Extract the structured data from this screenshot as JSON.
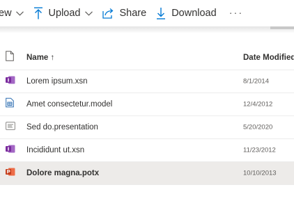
{
  "toolbar": {
    "view_label": "ew",
    "upload_label": "Upload",
    "share_label": "Share",
    "download_label": "Download",
    "more_label": "···"
  },
  "columns": {
    "name": "Name ↑",
    "date": "Date Modified"
  },
  "files": [
    {
      "name": "Lorem ipsum.xsn",
      "date": "8/1/2014",
      "icon": "infopath-file-icon",
      "color": "#7b2c9e"
    },
    {
      "name": "Amet consectetur.model",
      "date": "12/4/2012",
      "icon": "model-file-icon",
      "color": "#2b6cb0"
    },
    {
      "name": "Sed do.presentation",
      "date": "5/20/2020",
      "icon": "presentation-file-icon",
      "color": "#8a8886"
    },
    {
      "name": "Incididunt ut.xsn",
      "date": "11/23/2012",
      "icon": "infopath-file-icon",
      "color": "#7b2c9e"
    },
    {
      "name": "Dolore magna.potx",
      "date": "10/10/2013",
      "icon": "powerpoint-template-icon",
      "color": "#c43e1c",
      "selected": true
    }
  ],
  "colors": {
    "accent": "#0078d4",
    "selected_row": "#edebe9"
  }
}
